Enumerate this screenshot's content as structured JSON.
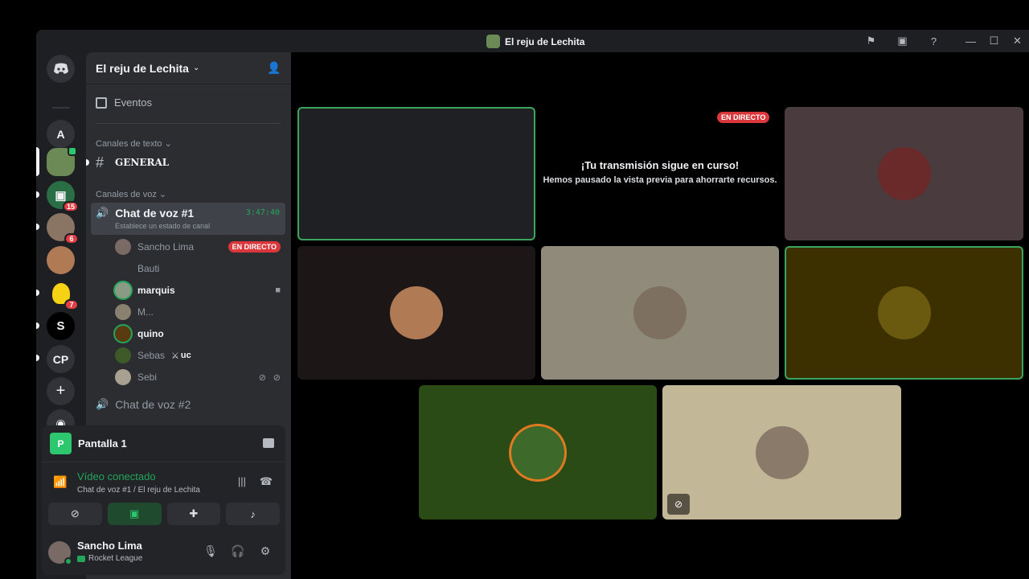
{
  "window": {
    "title": "El reju de Lechita"
  },
  "titlebar_icons": [
    "flag-icon",
    "inbox-icon",
    "help-icon"
  ],
  "rail": {
    "home_icon": "discord-icon",
    "servers": [
      {
        "label": "A",
        "badge": ""
      },
      {
        "label": "",
        "badge": ""
      },
      {
        "label": "",
        "badge": "15"
      },
      {
        "label": "",
        "badge": "6"
      },
      {
        "label": "",
        "badge": ""
      },
      {
        "label": "",
        "badge": "7"
      },
      {
        "label": "",
        "badge": ""
      },
      {
        "label": "CP",
        "badge": ""
      }
    ],
    "add_icon": "plus-icon",
    "discover_icon": "compass-icon"
  },
  "sidebar": {
    "guild_name": "El reju de Lechita",
    "events_label": "Eventos",
    "text_category": "Canales de texto",
    "text_channel": "GENERAL",
    "voice_category": "Canales de voz",
    "voice_channel_1": {
      "name": "Chat de voz #1",
      "timer": "3:47:40",
      "status": "Establece un estado de canal"
    },
    "voice_users": [
      {
        "name": "Sancho Lima",
        "live": "EN DIRECTO"
      },
      {
        "name": "Bauti"
      },
      {
        "name": "marquis"
      },
      {
        "name": "M..."
      },
      {
        "name": "quino"
      },
      {
        "name": "Sebas",
        "tag": "uc"
      },
      {
        "name": "Sebi"
      }
    ],
    "voice_channel_2": {
      "name": "Chat de voz #2"
    }
  },
  "panel": {
    "screen_share": {
      "name": "Pantalla 1",
      "thumb_letter": "P"
    },
    "rtc": {
      "title": "Vídeo conectado",
      "subtitle": "Chat de voz #1 / El reju de Lechita"
    },
    "user": {
      "name": "Sancho Lima",
      "status": "Rocket League"
    }
  },
  "stage": {
    "stream": {
      "live_label": "EN DIRECTO",
      "title": "¡Tu transmisión sigue en curso!",
      "subtitle": "Hemos pausado la vista previa para ahorrarte recursos."
    },
    "tile_colors": [
      "#1f2023",
      "#4a3b3e",
      "#1c1617",
      "#8f8a7a",
      "#3d3000",
      "#2a4a16",
      "#c2b797"
    ]
  },
  "colors": {
    "green": "#23a55a",
    "red": "#da373c",
    "bg": "#1e1f22",
    "sidebar": "#2b2d31"
  }
}
